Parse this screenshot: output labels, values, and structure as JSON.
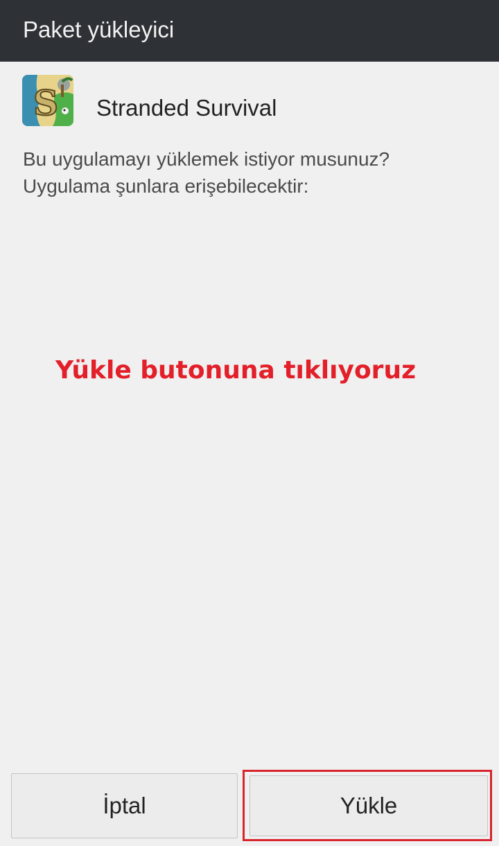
{
  "titlebar": {
    "title": "Paket yükleyici"
  },
  "app": {
    "name": "Stranded Survival",
    "icon": "stranded-survival-app-icon"
  },
  "question": {
    "line1": "Bu uygulamayı yüklemek istiyor musunuz?",
    "line2": "Uygulama şunlara erişebilecektir:"
  },
  "annotation": {
    "text": "Yükle butonuna tıklıyoruz",
    "color": "#e3202a"
  },
  "buttons": {
    "cancel_label": "İptal",
    "install_label": "Yükle"
  },
  "colors": {
    "titlebar": "#2e3135",
    "background": "#f0f0f0",
    "highlight": "#d8242c"
  }
}
